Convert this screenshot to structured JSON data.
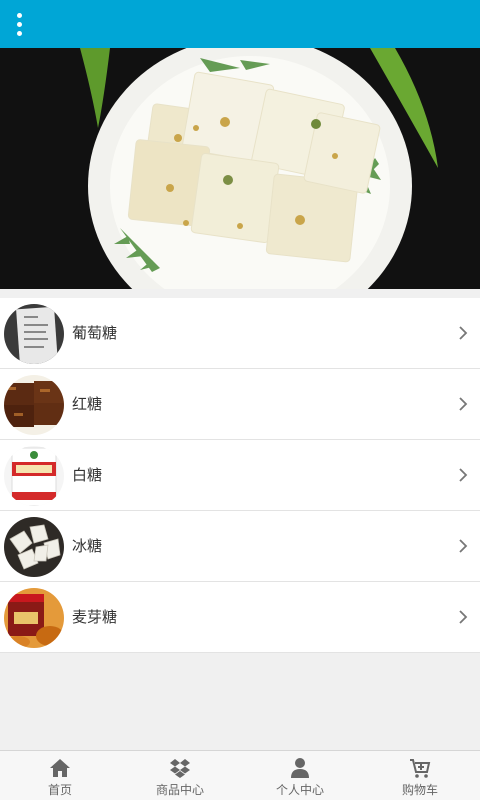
{
  "header": {
    "menu_icon": "more-vertical-icon",
    "background_color": "#00a6d6"
  },
  "banner": {
    "slide_count": 3,
    "active_slide": 1,
    "image": "sugar-cubes-on-plate-photo"
  },
  "categories": [
    {
      "label": "葡萄糖",
      "thumb": "glucose-bag-photo"
    },
    {
      "label": "红糖",
      "thumb": "brown-sugar-blocks-photo"
    },
    {
      "label": "白糖",
      "thumb": "white-sugar-pack-photo"
    },
    {
      "label": "冰糖",
      "thumb": "rock-sugar-photo"
    },
    {
      "label": "麦芽糖",
      "thumb": "maltose-jar-photo"
    }
  ],
  "tabbar": {
    "tabs": [
      {
        "label": "首页",
        "icon": "home-icon"
      },
      {
        "label": "商品中心",
        "icon": "dropbox-icon"
      },
      {
        "label": "个人中心",
        "icon": "user-icon"
      },
      {
        "label": "购物车",
        "icon": "cart-icon"
      }
    ]
  }
}
